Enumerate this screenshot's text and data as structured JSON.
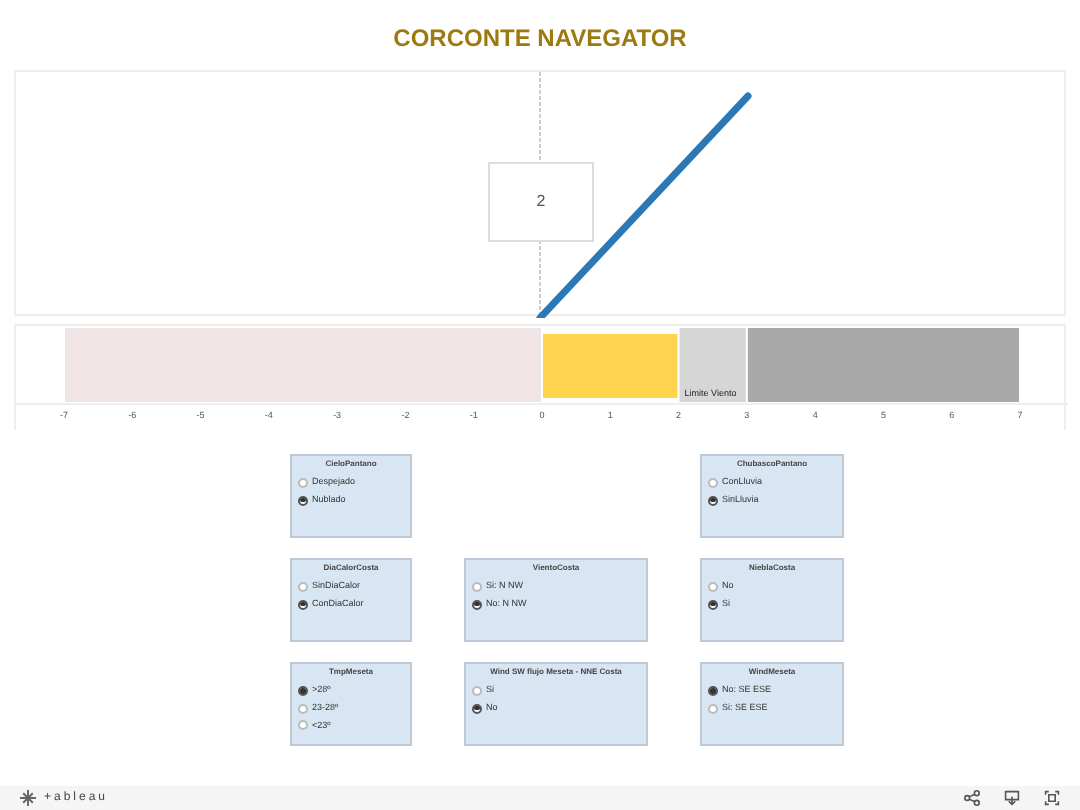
{
  "title": "CORCONTE NAVEGATOR",
  "line_chart": {
    "label": "2"
  },
  "gauge": {
    "chart_data": {
      "type": "bar",
      "orientation": "horizontal",
      "stacked": true,
      "xlim": [
        -7,
        7
      ],
      "xticks": [
        -7,
        -6,
        -5,
        -4,
        -3,
        -2,
        -1,
        0,
        1,
        2,
        3,
        4,
        5,
        6,
        7
      ],
      "series": [
        {
          "color": "#f0e4e4",
          "values": [
            -7
          ]
        },
        {
          "color": "#ffd54f",
          "values": [
            2
          ]
        },
        {
          "color": "#d6d6d6",
          "values": [
            1
          ]
        },
        {
          "color": "#a9a9a9",
          "values": [
            4
          ]
        }
      ],
      "annotations": [
        {
          "x": 2,
          "text": "Limite Viento"
        }
      ]
    }
  },
  "filter_rows": [
    [
      {
        "title": "CieloPantano",
        "options": [
          {
            "label": "Despejado",
            "selected": false
          },
          {
            "label": "Nublado",
            "selected": true
          }
        ]
      },
      null,
      {
        "title": "ChubascoPantano",
        "options": [
          {
            "label": "ConLluvia",
            "selected": false
          },
          {
            "label": "SinLluvia",
            "selected": true
          }
        ]
      }
    ],
    [
      {
        "title": "DiaCalorCosta",
        "options": [
          {
            "label": "SinDiaCalor",
            "selected": false
          },
          {
            "label": "ConDiaCalor",
            "selected": true
          }
        ]
      },
      {
        "title": "VientoCosta",
        "options": [
          {
            "label": "Si: N NW",
            "selected": false
          },
          {
            "label": "No: N NW",
            "selected": true
          }
        ]
      },
      {
        "title": "NieblaCosta",
        "options": [
          {
            "label": "No",
            "selected": false
          },
          {
            "label": "Si",
            "selected": true
          }
        ]
      }
    ],
    [
      {
        "title": "TmpMeseta",
        "options": [
          {
            "label": ">28º",
            "selected": true
          },
          {
            "label": "23-28º",
            "selected": false
          },
          {
            "label": "<23º",
            "selected": false
          }
        ]
      },
      {
        "title": "Wind SW flujo Meseta - NNE Costa",
        "options": [
          {
            "label": "Si",
            "selected": false
          },
          {
            "label": "No",
            "selected": true
          }
        ]
      },
      {
        "title": "WindMeseta",
        "options": [
          {
            "label": "No: SE ESE",
            "selected": true
          },
          {
            "label": "Si: SE ESE",
            "selected": false
          }
        ]
      }
    ]
  ],
  "footer": {
    "brand": "+ableau"
  }
}
